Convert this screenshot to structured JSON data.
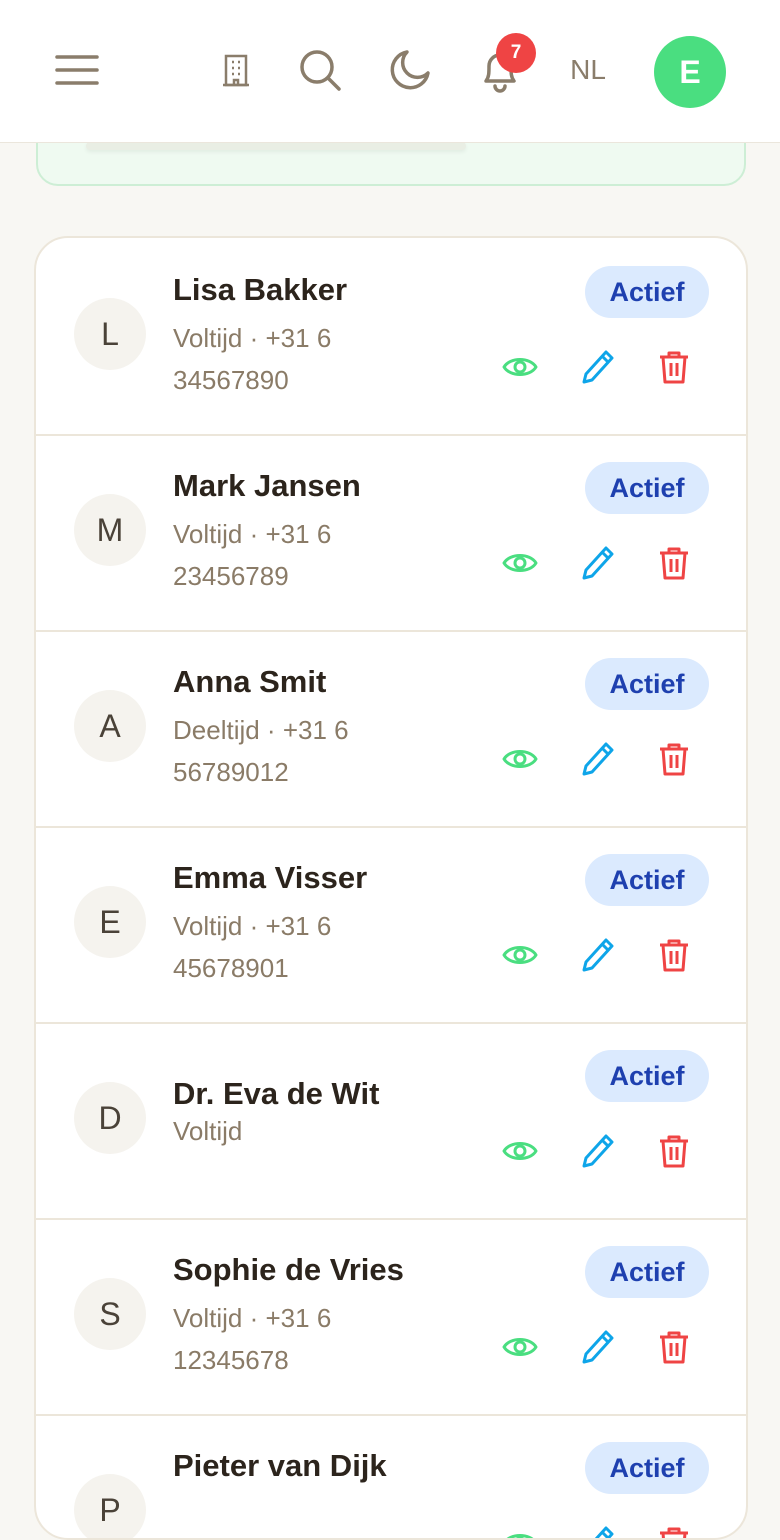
{
  "header": {
    "notification_count": "7",
    "language": "NL",
    "user_initial": "E",
    "icons": [
      "menu-icon",
      "building-icon",
      "search-icon",
      "moon-icon",
      "bell-icon"
    ]
  },
  "colors": {
    "accent_green": "#4ade80",
    "badge_red": "#ef4444",
    "status_bg": "#dbeafe",
    "status_text": "#1e40af",
    "view_icon": "#4ade80",
    "edit_icon": "#0ea5e9",
    "delete_icon": "#ef4444"
  },
  "staff": [
    {
      "initial": "L",
      "name": "Lisa Bakker",
      "meta": "Voltijd · +31 6 34567890",
      "status": "Actief"
    },
    {
      "initial": "M",
      "name": "Mark Jansen",
      "meta": "Voltijd · +31 6 23456789",
      "status": "Actief"
    },
    {
      "initial": "A",
      "name": "Anna Smit",
      "meta": "Deeltijd · +31 6 56789012",
      "status": "Actief"
    },
    {
      "initial": "E",
      "name": "Emma Visser",
      "meta": "Voltijd · +31 6 45678901",
      "status": "Actief"
    },
    {
      "initial": "D",
      "name": "Dr. Eva de Wit",
      "meta": "Voltijd",
      "status": "Actief"
    },
    {
      "initial": "S",
      "name": "Sophie de Vries",
      "meta": "Voltijd · +31 6 12345678",
      "status": "Actief"
    },
    {
      "initial": "P",
      "name": "Pieter van Dijk",
      "meta": "",
      "status": "Actief"
    }
  ]
}
